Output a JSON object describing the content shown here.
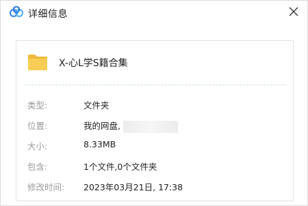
{
  "window": {
    "title": "详细信息",
    "logo_icon": "baidu-netdisk-logo",
    "close_icon": "close-icon"
  },
  "file": {
    "name": "X-心L学S籍合集",
    "icon": "folder-icon",
    "icon_color": "#f5c94a"
  },
  "details": [
    {
      "label": "类型:",
      "value": "文件夹"
    },
    {
      "label": "位置:",
      "value": "我的网盘,"
    },
    {
      "label": "大小:",
      "value": "8.33MB"
    },
    {
      "label": "包含:",
      "value": "1个文件,0个文件夹"
    },
    {
      "label": "修改时间:",
      "value": "2023年03月21日, 17:38"
    }
  ],
  "colors": {
    "logo_blue": "#3b8ef0",
    "label_gray": "#9a9a9a",
    "divider": "#c6dbe6"
  }
}
